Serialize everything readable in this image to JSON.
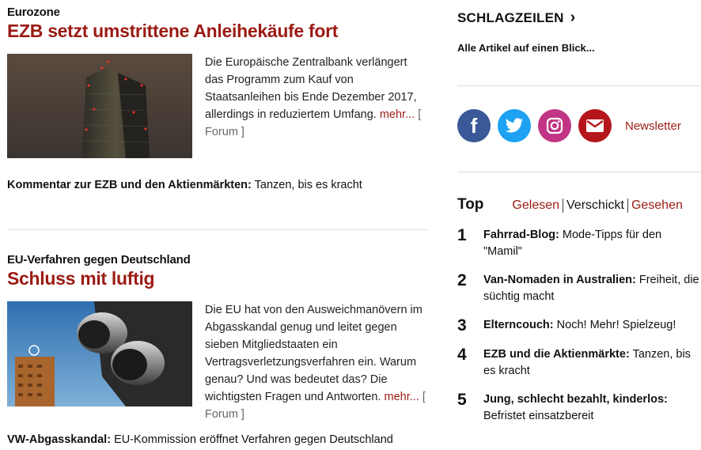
{
  "article1": {
    "kicker": "Eurozone",
    "headline": "EZB setzt umstrittene Anleihekäufe fort",
    "teaser": "Die Europäische Zentralbank verlängert das Programm zum Kauf von Staatsanleihen bis Ende Dezember 2017, allerdings in reduziertem Umfang.",
    "more": "mehr...",
    "forum": "[ Forum ]",
    "related_bold": "Kommentar zur EZB und den Aktienmärkten:",
    "related_text": "Tanzen, bis es kracht"
  },
  "article2": {
    "kicker": "EU-Verfahren gegen Deutschland",
    "headline": "Schluss mit luftig",
    "teaser": "Die EU hat von den Ausweichmanövern im Abgasskandal genug und leitet gegen sieben Mitgliedstaaten ein Vertragsverletzungsverfahren ein. Warum genau? Und was bedeutet das? Die wichtigsten Fragen und Antworten.",
    "more": "mehr...",
    "forum": "[ Forum ]",
    "related_bold": "VW-Abgasskandal:",
    "related_text": "EU-Kommission eröffnet Verfahren gegen Deutschland"
  },
  "sidebar": {
    "schlagzeilen": "SCHLAGZEILEN",
    "schlagzeilen_arrow": "›",
    "schlagzeilen_sub": "Alle Artikel auf einen Blick...",
    "newsletter": "Newsletter",
    "social_colors": {
      "facebook": "#3b5998",
      "twitter": "#1da1f2",
      "instagram": "#c13584",
      "newsletter": "#b5161b"
    },
    "top_title": "Top",
    "tabs": [
      "Gelesen",
      "Verschickt",
      "Gesehen"
    ],
    "top_items": [
      {
        "num": "1",
        "bold": "Fahrrad-Blog:",
        "text": "Mode-Tipps für den \"Mamil\""
      },
      {
        "num": "2",
        "bold": "Van-Nomaden in Australien:",
        "text": "Freiheit, die süchtig macht"
      },
      {
        "num": "3",
        "bold": "Elterncouch:",
        "text": "Noch! Mehr! Spielzeug!"
      },
      {
        "num": "4",
        "bold": "EZB und die Aktienmärkte:",
        "text": "Tanzen, bis es kracht"
      },
      {
        "num": "5",
        "bold": "Jung, schlecht bezahlt, kinderlos:",
        "text": "Befristet einsatzbereit"
      }
    ]
  }
}
